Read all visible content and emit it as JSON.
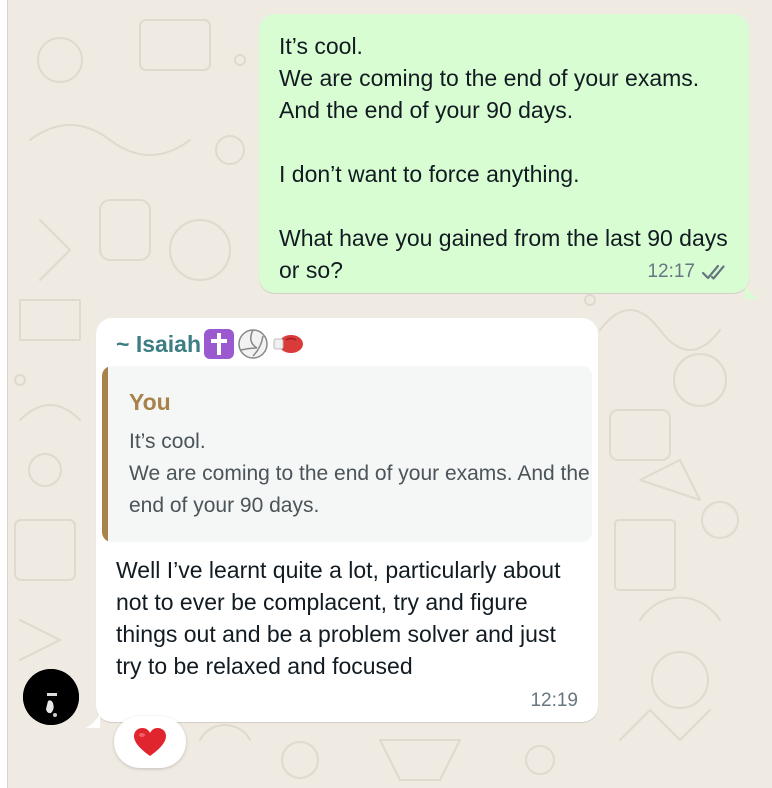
{
  "chat": {
    "messages": [
      {
        "direction": "outgoing",
        "text": "It’s cool.\nWe are coming to the end of your exams. And the end of your 90 days.\n\nI don’t want to force anything.\n\nWhat have you gained from the last 90 days or so?",
        "time": "12:17",
        "status_icon": "double-check-icon"
      },
      {
        "direction": "incoming",
        "sender": "~ Isaiah",
        "sender_emoji": [
          "latin-cross-emoji",
          "volleyball-emoji",
          "boxing-glove-emoji"
        ],
        "quoted": {
          "author": "You",
          "text": "It’s cool.\nWe are coming to the end of your exams. And the end of your 90 days."
        },
        "text": "Well I’ve learnt quite a lot, particularly about not to ever be complacent, try and figure things out and be a problem solver and just try to be relaxed and focused",
        "time": "12:19",
        "reaction": "red-heart-emoji",
        "avatar": "avatar"
      }
    ]
  },
  "colors": {
    "outgoing_bubble": "#d9fdd3",
    "incoming_bubble": "#ffffff",
    "chat_background": "#efeae2",
    "sender_name": "#3d7d84",
    "quote_accent": "#a8824a"
  }
}
